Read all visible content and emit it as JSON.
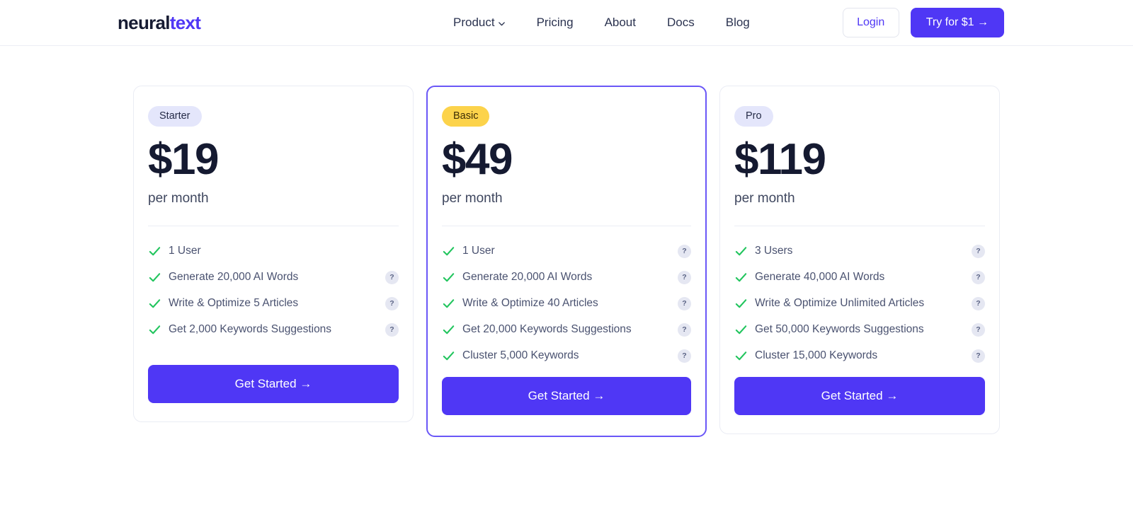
{
  "header": {
    "logo": {
      "part1": "neural",
      "part2": "text"
    },
    "nav": [
      {
        "label": "Product",
        "icon": "chevron-down-icon",
        "has_dropdown": true
      },
      {
        "label": "Pricing",
        "has_dropdown": false
      },
      {
        "label": "About",
        "has_dropdown": false
      },
      {
        "label": "Docs",
        "has_dropdown": false
      },
      {
        "label": "Blog",
        "has_dropdown": false
      }
    ],
    "login_label": "Login",
    "cta_label": "Try for $1 →"
  },
  "colors": {
    "accent": "#4f37f5",
    "featured_border": "#6a57f7",
    "badge_accent_bg": "#fcd34b",
    "badge_plain_bg": "#e4e6fb",
    "check_green": "#22c55e",
    "price_text": "#151a31"
  },
  "plans": [
    {
      "badge": "Starter",
      "badge_style": "plain",
      "price": "$19",
      "period": "per month",
      "featured": false,
      "cta_label": "Get Started →",
      "features": [
        {
          "label": "1 User",
          "help": false
        },
        {
          "label": "Generate 20,000 AI Words",
          "help": true
        },
        {
          "label": "Write & Optimize 5 Articles",
          "help": true
        },
        {
          "label": "Get 2,000 Keywords Suggestions",
          "help": true
        }
      ]
    },
    {
      "badge": "Basic",
      "badge_style": "accent",
      "price": "$49",
      "period": "per month",
      "featured": true,
      "cta_label": "Get Started →",
      "features": [
        {
          "label": "1 User",
          "help": true
        },
        {
          "label": "Generate 20,000 AI Words",
          "help": true
        },
        {
          "label": "Write & Optimize 40 Articles",
          "help": true
        },
        {
          "label": "Get 20,000 Keywords Suggestions",
          "help": true
        },
        {
          "label": "Cluster 5,000 Keywords",
          "help": true
        }
      ]
    },
    {
      "badge": "Pro",
      "badge_style": "plain",
      "price": "$119",
      "period": "per month",
      "featured": false,
      "cta_label": "Get Started →",
      "features": [
        {
          "label": "3 Users",
          "help": true
        },
        {
          "label": "Generate 40,000 AI Words",
          "help": true
        },
        {
          "label": "Write & Optimize Unlimited Articles",
          "help": true
        },
        {
          "label": "Get 50,000 Keywords Suggestions",
          "help": true
        },
        {
          "label": "Cluster 15,000 Keywords",
          "help": true
        }
      ]
    }
  ],
  "help_badge_label": "?"
}
